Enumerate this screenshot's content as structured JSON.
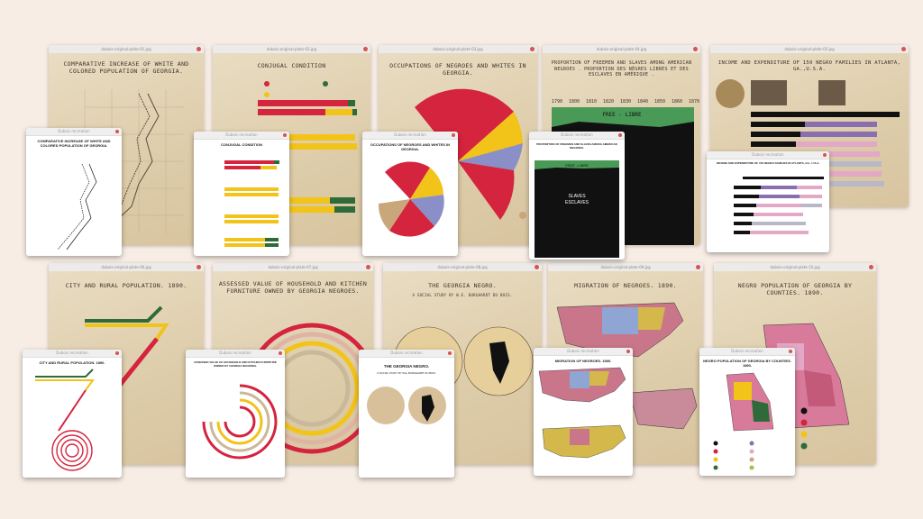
{
  "background": "#f7ede4",
  "colors": {
    "red": "#d4243e",
    "gold": "#f2c318",
    "green": "#2f6b3a",
    "tan": "#c9a77a",
    "black": "#111111",
    "purple": "#8a6fb0",
    "pink": "#e2a8c6",
    "blue": "#7d8fd6"
  },
  "filenames": {
    "row1": [
      "dubois-original-plate-01.jpg",
      "dubois-original-plate-02.jpg",
      "dubois-original-plate-03.jpg",
      "dubois-original-plate-04.jpg",
      "dubois-original-plate-05.jpg"
    ],
    "row2": [
      "dubois-original-plate-06.jpg",
      "dubois-original-plate-07.jpg",
      "dubois-original-plate-08.jpg",
      "dubois-original-plate-09.jpg",
      "dubois-original-plate-10.jpg"
    ]
  },
  "originals": [
    {
      "title": "COMPARATIVE INCREASE OF WHITE AND COLORED POPULATION OF GEORGIA."
    },
    {
      "title": "CONJUGAL CONDITION"
    },
    {
      "title": "OCCUPATIONS OF NEGROES AND WHITES IN GEORGIA."
    },
    {
      "title": "PROPORTION OF FREEMEN AND SLAVES AMONG AMERICAN NEGROES . PROPORTION DES NÈGRES LIBRES ET DES ESCLAVES EN AMÉRIQUE .",
      "free_label": "FREE - LIBRE",
      "years": [
        "1790",
        "1800",
        "1810",
        "1820",
        "1830",
        "1840",
        "1850",
        "1860",
        "1870"
      ]
    },
    {
      "title": "INCOME AND EXPENDITURE OF 150 NEGRO FAMILIES IN ATLANTA, GA.,U.S.A."
    },
    {
      "title": "CITY AND RURAL POPULATION. 1890."
    },
    {
      "title": "ASSESSED VALUE OF HOUSEHOLD AND KITCHEN FURNITURE OWNED BY GEORGIA NEGROES."
    },
    {
      "title": "THE GEORGIA NEGRO.",
      "subtitle": "A SOCIAL STUDY BY W.E. BURGHARDT DU BOIS."
    },
    {
      "title": "MIGRATION OF NEGROES. 1890."
    },
    {
      "title": "NEGRO POPULATION OF GEORGIA BY COUNTIES. 1890."
    }
  ],
  "recreations": [
    {
      "title": "COMPARATIVE INCREASE OF WHITE AND COLORED POPULATION OF GEORGIA."
    },
    {
      "title": "CONJUGAL CONDITION"
    },
    {
      "title": "OCCUPATIONS OF NEGROES AND WHITES IN GEORGIA."
    },
    {
      "title": "PROPORTION OF FREEMEN AND SLAVES AMONG AMERICAN NEGROES.",
      "free_label": "FREE - LIBRE",
      "slaves_label": "SLAVES",
      "esclaves_label": "ESCLAVES"
    },
    {
      "title": "INCOME AND EXPENDITURE OF 150 NEGRO FAMILIES IN ATLANTA, GA., U.S.A."
    },
    {
      "title": "CITY AND RURAL POPULATION. 1890."
    },
    {
      "title": "ASSESSED VALUE OF HOUSEHOLD AND KITCHEN FURNITURE OWNED BY GEORGIA NEGROES."
    },
    {
      "title": "THE GEORGIA NEGRO.",
      "subtitle": "A SOCIAL STUDY BY W.E. BURGHARDT DU BOIS."
    },
    {
      "title": "MIGRATION OF NEGROES. 1890."
    },
    {
      "title": "NEGRO POPULATION OF GEORGIA BY COUNTIES. 1890."
    }
  ],
  "window_title": "Dubois recreation"
}
